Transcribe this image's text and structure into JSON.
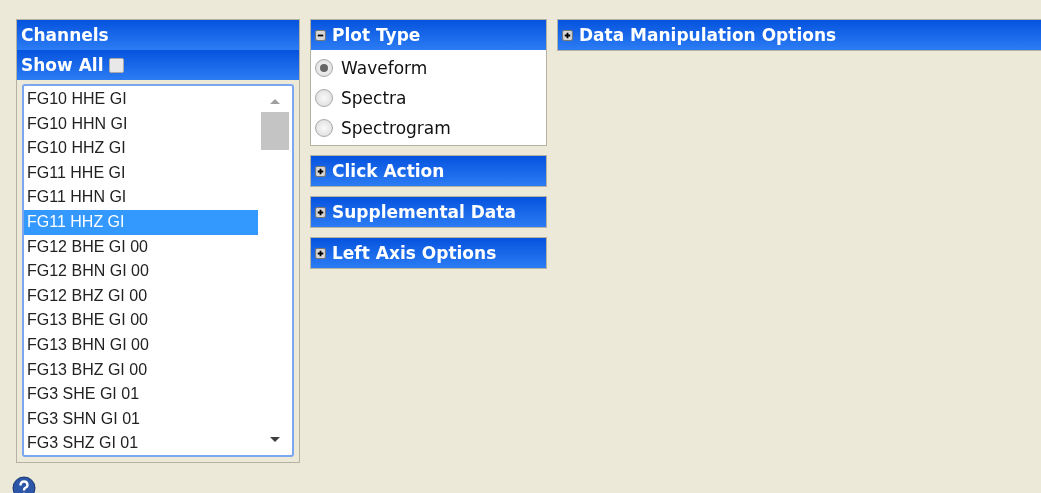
{
  "channels": {
    "title": "Channels",
    "show_all": {
      "label": "Show All",
      "checked": false
    },
    "items": [
      {
        "label": "FG10 HHE GI",
        "selected": false
      },
      {
        "label": "FG10 HHN GI",
        "selected": false
      },
      {
        "label": "FG10 HHZ GI",
        "selected": false
      },
      {
        "label": "FG11 HHE GI",
        "selected": false
      },
      {
        "label": "FG11 HHN GI",
        "selected": false
      },
      {
        "label": "FG11 HHZ GI",
        "selected": true
      },
      {
        "label": "FG12 BHE GI 00",
        "selected": false
      },
      {
        "label": "FG12 BHN GI 00",
        "selected": false
      },
      {
        "label": "FG12 BHZ GI 00",
        "selected": false
      },
      {
        "label": "FG13 BHE GI 00",
        "selected": false
      },
      {
        "label": "FG13 BHN GI 00",
        "selected": false
      },
      {
        "label": "FG13 BHZ GI 00",
        "selected": false
      },
      {
        "label": "FG3 SHE GI 01",
        "selected": false
      },
      {
        "label": "FG3 SHN GI 01",
        "selected": false
      },
      {
        "label": "FG3 SHZ GI 01",
        "selected": false
      }
    ]
  },
  "panels": [
    {
      "title": "Plot Type",
      "expanded": true,
      "options": [
        {
          "label": "Waveform",
          "selected": true
        },
        {
          "label": "Spectra",
          "selected": false
        },
        {
          "label": "Spectrogram",
          "selected": false
        }
      ]
    },
    {
      "title": "Click Action",
      "expanded": false
    },
    {
      "title": "Supplemental Data",
      "expanded": false
    },
    {
      "title": "Left Axis Options",
      "expanded": false
    }
  ],
  "right_panel": {
    "title": "Data Manipulation Options",
    "expanded": false
  }
}
